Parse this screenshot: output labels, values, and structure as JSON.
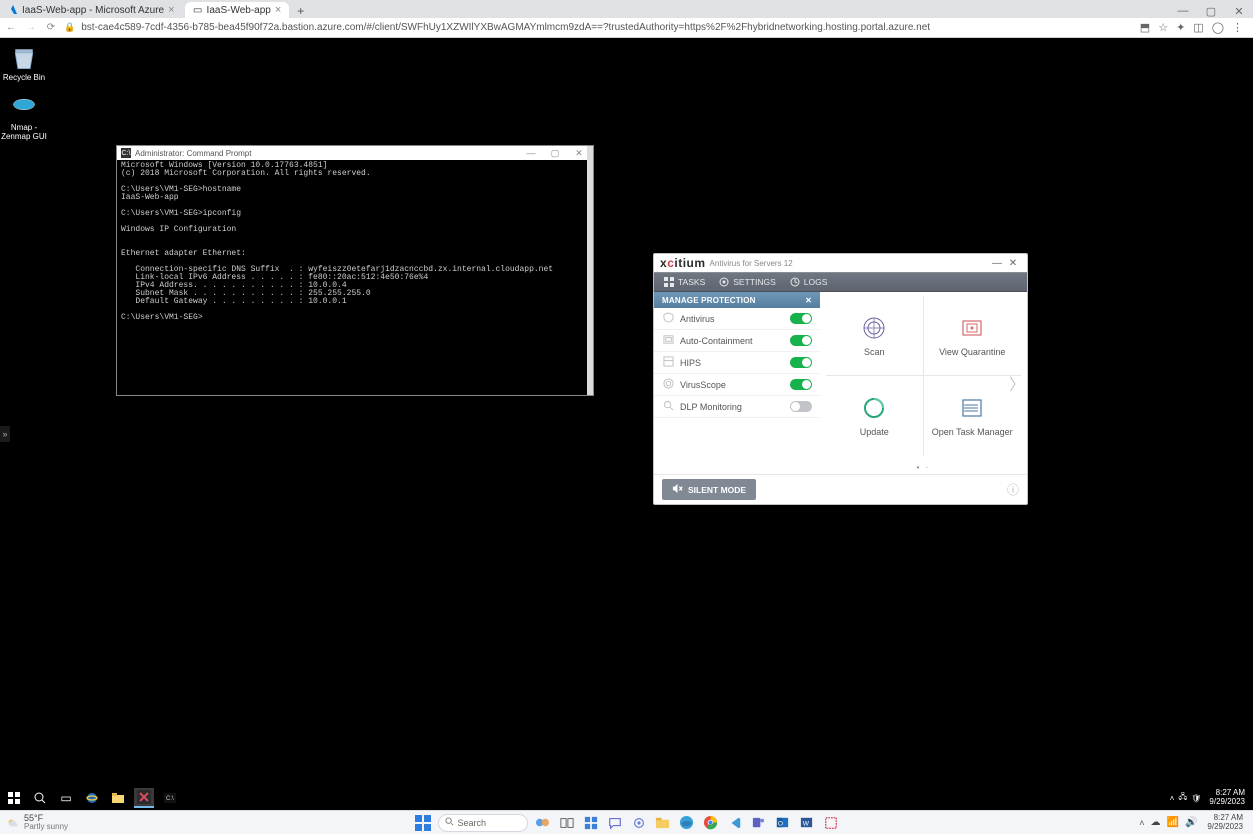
{
  "browser": {
    "tabs": [
      {
        "title": "IaaS-Web-app - Microsoft Azure"
      },
      {
        "title": "IaaS-Web-app"
      }
    ],
    "url": "bst-cae4c589-7cdf-4356-b785-bea45f90f72a.bastion.azure.com/#/client/SWFhUy1XZWIlYXBwAGMAYmlmcm9zdA==?trustedAuthority=https%2F%2Fhybridnetworking.hosting.portal.azure.net"
  },
  "desktop_icons": {
    "recycle": "Recycle Bin",
    "nmap": "Nmap -\nZenmap GUI"
  },
  "cmd": {
    "title": "Administrator: Command Prompt",
    "body": "Microsoft Windows [Version 10.0.17763.4851]\n(c) 2018 Microsoft Corporation. All rights reserved.\n\nC:\\Users\\VM1-SEG>hostname\nIaaS-Web-app\n\nC:\\Users\\VM1-SEG>ipconfig\n\nWindows IP Configuration\n\n\nEthernet adapter Ethernet:\n\n   Connection-specific DNS Suffix  . : wyfeiszz0etefarj1dzacnccbd.zx.internal.cloudapp.net\n   Link-local IPv6 Address . . . . . : fe80::20ac:512:4e50:76e%4\n   IPv4 Address. . . . . . . . . . . : 10.0.0.4\n   Subnet Mask . . . . . . . . . . . : 255.255.255.0\n   Default Gateway . . . . . . . . . : 10.0.0.1\n\nC:\\Users\\VM1-SEG>"
  },
  "xc": {
    "logo": "xcitium",
    "subtitle": "Antivirus for Servers  12",
    "menu": {
      "tasks": "TASKS",
      "settings": "SETTINGS",
      "logs": "LOGS"
    },
    "panel_title": "MANAGE PROTECTION",
    "rows": {
      "antivirus": "Antivirus",
      "autocontain": "Auto-Containment",
      "hips": "HIPS",
      "viruscope": "VirusScope",
      "dlp": "DLP Monitoring"
    },
    "tiles": {
      "scan": "Scan",
      "quarantine": "View Quarantine",
      "update": "Update",
      "taskmgr": "Open Task Manager"
    },
    "silent": "SILENT MODE"
  },
  "remote_taskbar": {
    "time": "8:27 AM",
    "date": "9/29/2023"
  },
  "host_taskbar": {
    "temp": "55°F",
    "condition": "Partly sunny",
    "search_placeholder": "Search",
    "time": "8:27 AM",
    "date": "9/29/2023"
  }
}
